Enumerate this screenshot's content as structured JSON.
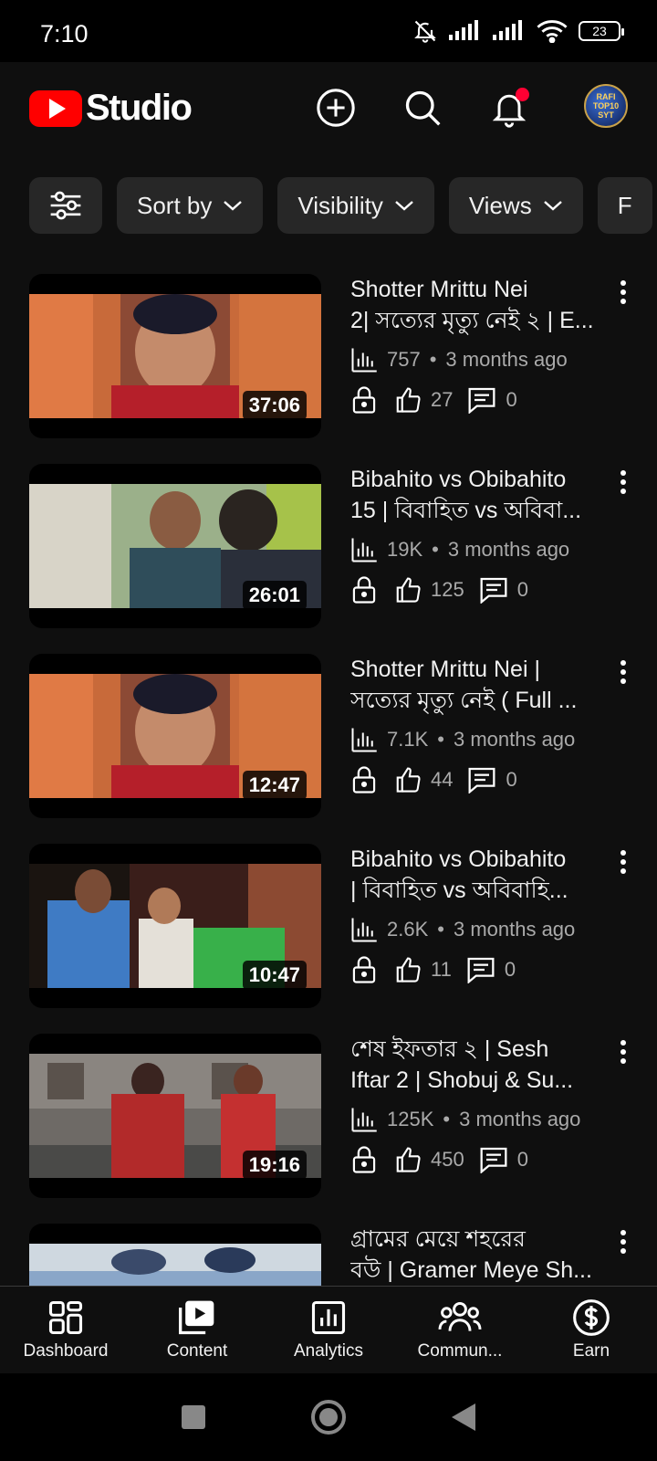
{
  "status_bar": {
    "time": "7:10",
    "battery": "23"
  },
  "header": {
    "logo_text": "Studio",
    "avatar_text": "RAFI TOP10 SYT"
  },
  "filters": [
    {
      "label": "Sort by"
    },
    {
      "label": "Visibility"
    },
    {
      "label": "Views"
    },
    {
      "label": "F"
    }
  ],
  "videos": [
    {
      "title_line1": "Shotter Mrittu Nei",
      "title_line2": "2| সত্যের মৃত্যু নেই ২ | E...",
      "duration": "37:06",
      "views": "757",
      "age": "3 months ago",
      "likes": "27",
      "comments": "0"
    },
    {
      "title_line1": "Bibahito vs Obibahito",
      "title_line2": "15 | বিবাহিত vs অবিবা...",
      "duration": "26:01",
      "views": "19K",
      "age": "3 months ago",
      "likes": "125",
      "comments": "0"
    },
    {
      "title_line1": "Shotter Mrittu Nei |",
      "title_line2": "সত্যের মৃত্যু নেই ( Full ...",
      "duration": "12:47",
      "views": "7.1K",
      "age": "3 months ago",
      "likes": "44",
      "comments": "0"
    },
    {
      "title_line1": "Bibahito vs Obibahito",
      "title_line2": "| বিবাহিত vs অবিবাহি...",
      "duration": "10:47",
      "views": "2.6K",
      "age": "3 months ago",
      "likes": "11",
      "comments": "0"
    },
    {
      "title_line1": "শেষ ইফতার ২ | Sesh",
      "title_line2": "Iftar 2 | Shobuj & Su...",
      "duration": "19:16",
      "views": "125K",
      "age": "3 months ago",
      "likes": "450",
      "comments": "0"
    },
    {
      "title_line1": "গ্রামের মেয়ে শহরের",
      "title_line2": "বউ | Gramer Meye Sh...",
      "duration": "",
      "views": "",
      "age": "",
      "likes": "",
      "comments": ""
    }
  ],
  "bottom_nav": [
    {
      "label": "Dashboard",
      "icon": "dashboard-icon"
    },
    {
      "label": "Content",
      "icon": "content-icon"
    },
    {
      "label": "Analytics",
      "icon": "analytics-icon"
    },
    {
      "label": "Commun...",
      "icon": "community-icon"
    },
    {
      "label": "Earn",
      "icon": "earn-icon"
    }
  ],
  "colors": {
    "brand_red": "#ff0000",
    "background": "#0f0f0f",
    "chip": "#272727",
    "notification_dot": "#ff0033"
  }
}
